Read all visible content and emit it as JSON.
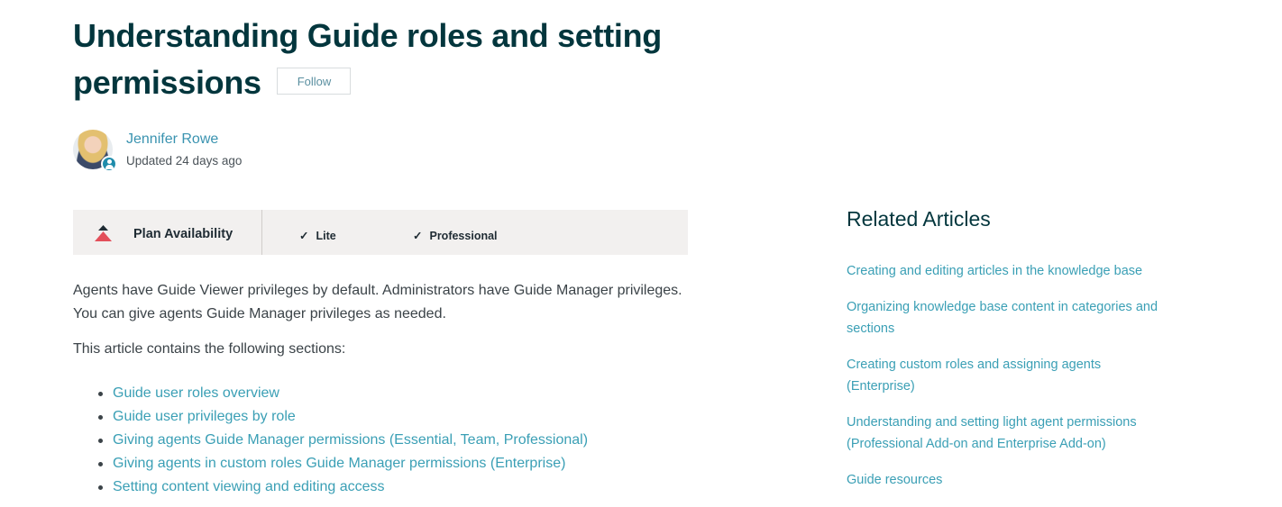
{
  "article": {
    "title": "Understanding Guide roles and setting permissions",
    "follow_label": "Follow"
  },
  "author": {
    "name": "Jennifer Rowe",
    "updated": "Updated 24 days ago"
  },
  "plan": {
    "label": "Plan Availability",
    "check_glyph": "✓",
    "options": [
      "Lite",
      "Professional"
    ]
  },
  "body": {
    "intro": "Agents have Guide Viewer privileges by default. Administrators have Guide Manager privileges. You can give agents Guide Manager privileges as needed.",
    "sections_intro": "This article contains the following sections:",
    "sections": [
      "Guide user roles overview",
      "Guide user privileges by role",
      "Giving agents Guide Manager permissions (Essential, Team, Professional)",
      "Giving agents in custom roles Guide Manager permissions (Enterprise)",
      "Setting content viewing and editing access"
    ]
  },
  "related": {
    "title": "Related Articles",
    "items": [
      "Creating and editing articles in the knowledge base",
      "Organizing knowledge base content in categories and sections",
      "Creating custom roles and assigning agents (Enterprise)",
      "Understanding and setting light agent permissions (Professional Add-on and Enterprise Add-on)",
      "Guide resources"
    ]
  },
  "colors": {
    "heading": "#03363d",
    "link": "#3a9fb5",
    "plan_bar_bg": "#f2f0ef",
    "plan_logo": "#e34f5a"
  },
  "icons": {
    "avatar_badge": "user-icon",
    "plan_logo": "zendesk-plan-logo-icon",
    "check": "check-icon"
  }
}
